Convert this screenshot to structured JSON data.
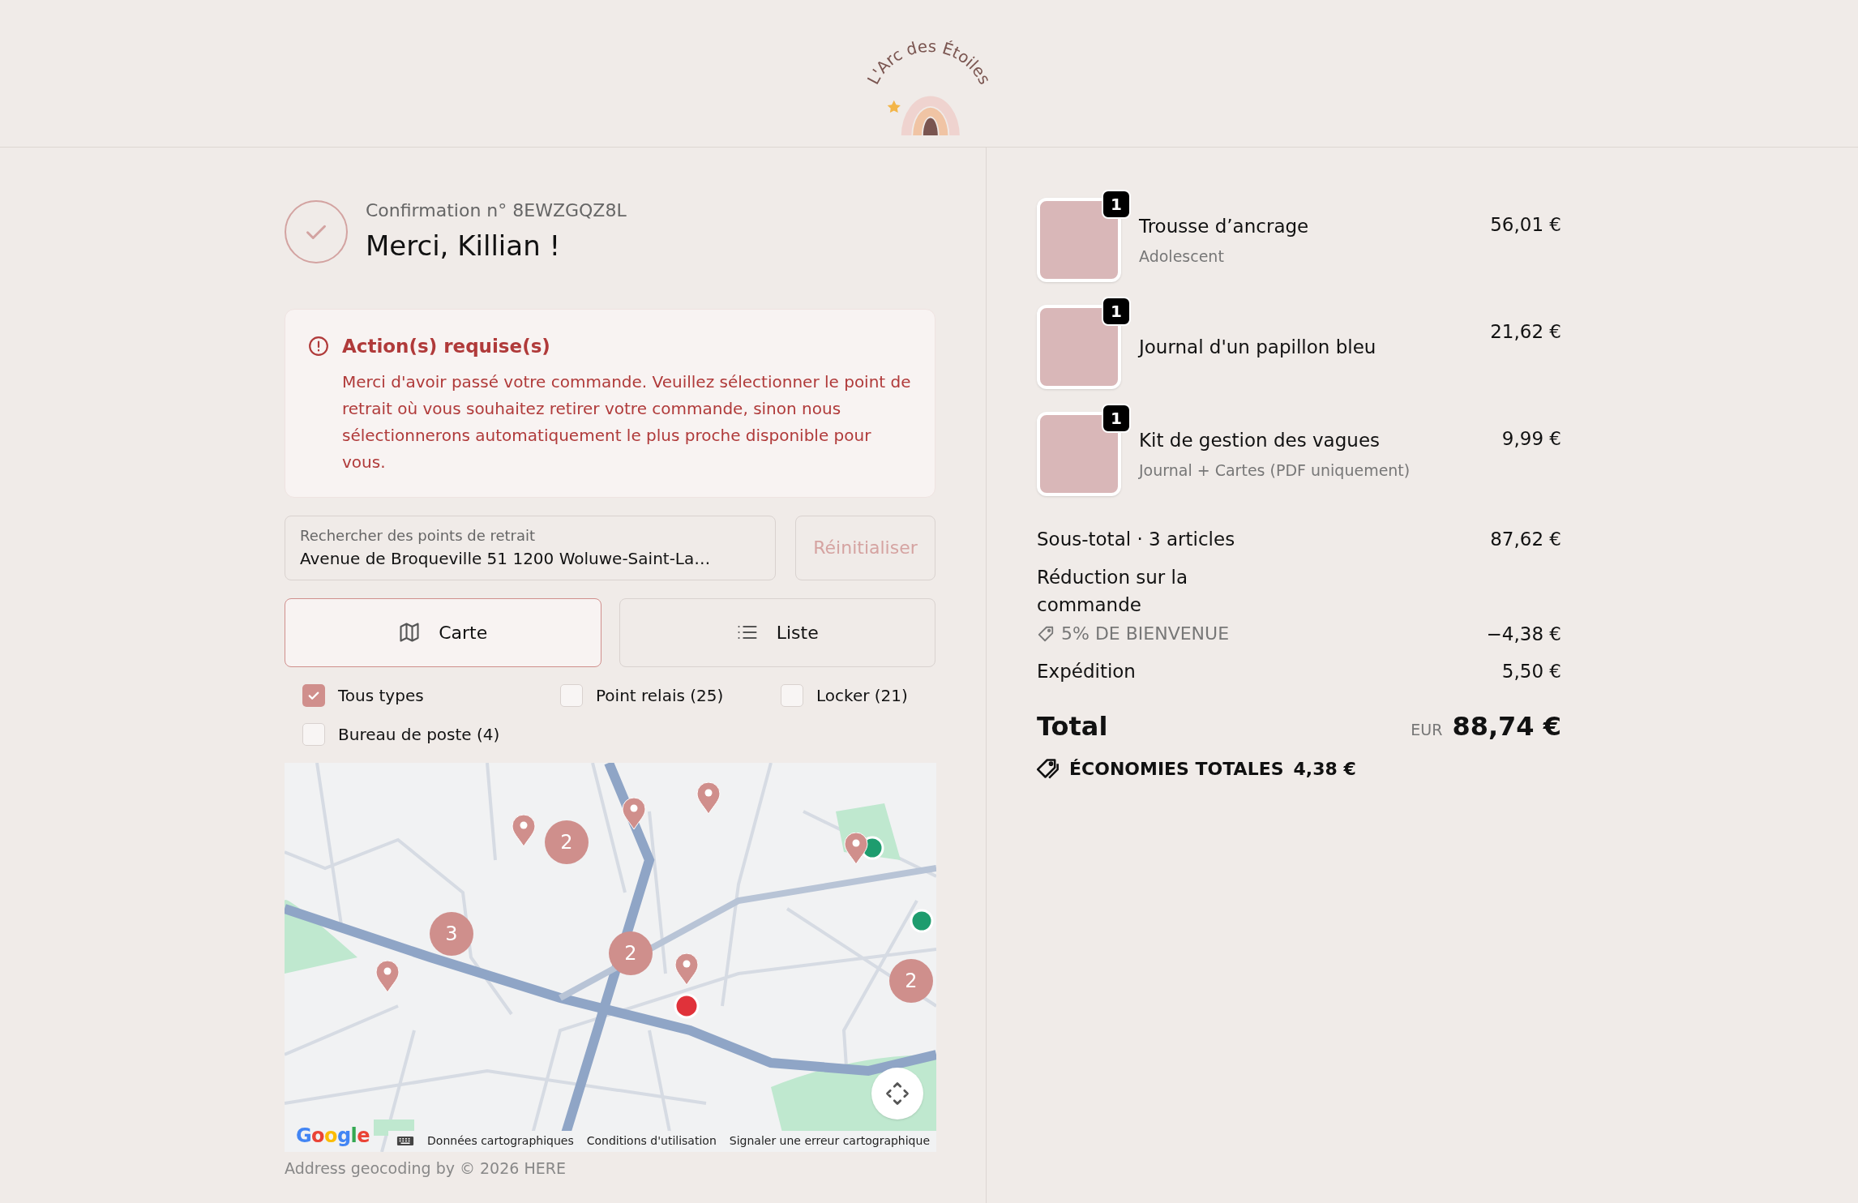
{
  "logo": {
    "text": "L'Arc des Étoiles"
  },
  "confirmation": {
    "number": "Confirmation n° 8EWZGQZ8L",
    "title": "Merci, Killian !"
  },
  "alert": {
    "title": "Action(s) requise(s)",
    "message": "Merci d'avoir passé votre commande. Veuillez sélectionner le point de retrait où vous souhaitez retirer votre commande, sinon nous sélectionnerons automatiquement le plus proche disponible pour vous."
  },
  "search": {
    "label": "Rechercher des points de retrait",
    "value": "Avenue de Broqueville 51 1200 Woluwe-Saint-La…"
  },
  "reset_button": {
    "label": "Réinitialiser",
    "disabled": true
  },
  "view_tabs": [
    {
      "kind": "map",
      "label": "Carte",
      "selected": true
    },
    {
      "kind": "list",
      "label": "Liste",
      "selected": false
    }
  ],
  "filters": [
    {
      "label": "Tous types",
      "checked": true
    },
    {
      "label": "Point relais (25)",
      "checked": false
    },
    {
      "label": "Locker (21)",
      "checked": false
    },
    {
      "label": "Bureau de poste (4)",
      "checked": false
    }
  ],
  "map": {
    "clusters": [
      {
        "count": "2"
      },
      {
        "count": "3"
      },
      {
        "count": "2"
      },
      {
        "count": "2"
      }
    ],
    "provider": "Google",
    "links": [
      "Données cartographiques",
      "Conditions d'utilisation",
      "Signaler une erreur cartographique"
    ]
  },
  "geocoding_note": "Address geocoding by © 2026 HERE",
  "order_items": [
    {
      "quantity": "1",
      "name": "Trousse d’ancrage",
      "variant": "Adolescent",
      "price": "56,01 €"
    },
    {
      "quantity": "1",
      "name": "Journal d'un papillon bleu",
      "price": "21,62 €"
    },
    {
      "quantity": "1",
      "name": "Kit de gestion des vagues",
      "variant": "Journal + Cartes (PDF uniquement)",
      "price": "9,99 €"
    }
  ],
  "summary": {
    "subtotal_label": "Sous-total · 3 articles",
    "subtotal": "87,62 €",
    "discount_label": "Réduction sur la commande",
    "discount_code": "5% DE BIENVENUE",
    "discount_amount": "−4,38 €",
    "shipping_label": "Expédition",
    "shipping": "5,50 €",
    "total_label": "Total",
    "currency": "EUR",
    "total": "88,74 €",
    "savings_label": "ÉCONOMIES TOTALES",
    "savings": "4,38 €"
  }
}
